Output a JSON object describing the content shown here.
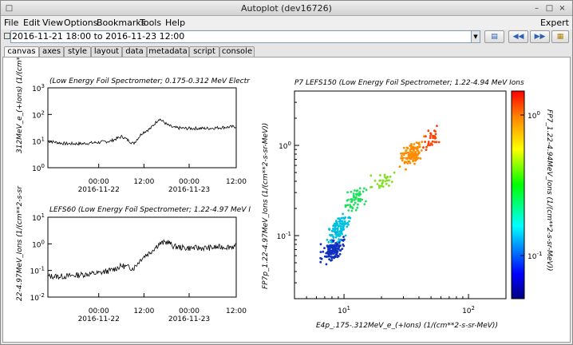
{
  "window": {
    "title": "Autoplot (dev16726)"
  },
  "menubar": {
    "items": [
      "File",
      "Edit",
      "View",
      "Options",
      "Bookmarks",
      "Tools",
      "Help"
    ],
    "expert_label": "Expert"
  },
  "address": {
    "value": "2016-11-21 18:00 to 2016-11-23 12:00"
  },
  "tabs": [
    "canvas",
    "axes",
    "style",
    "layout",
    "data",
    "metadata",
    "script",
    "console"
  ],
  "active_tab": "canvas",
  "icons": {
    "dropdown": "chevron-down-icon",
    "bookmark": "bookmark-icon",
    "prev": "step-back-icon",
    "next": "step-forward-icon",
    "open": "folder-icon"
  },
  "plots": {
    "top_left": {
      "title": "(Low Energy Foil Spectrometer; 0.175-0.312 MeV Electr",
      "ylabel": "312MeV_e_(+Ions) (1/(cm**2-s",
      "yticks": [
        {
          "base": "10",
          "exp": "3"
        },
        {
          "base": "10",
          "exp": "2"
        },
        {
          "base": "10",
          "exp": "1"
        },
        {
          "base": "10",
          "exp": "0"
        }
      ],
      "xticks": [
        "00:00",
        "12:00",
        "00:00",
        "12:00"
      ],
      "xdates": [
        "2016-11-22",
        "2016-11-23"
      ]
    },
    "bottom_left": {
      "title": "LEFS60 (Low Energy Foil Spectrometer; 1.22-4.97 MeV I",
      "ylabel": "22-4.97MeV_Ions (1/(cm**2-s-sr",
      "yticks": [
        {
          "base": "10",
          "exp": "1"
        },
        {
          "base": "10",
          "exp": "0"
        },
        {
          "base": "10",
          "exp": "-1"
        },
        {
          "base": "10",
          "exp": "-2"
        }
      ],
      "xticks": [
        "00:00",
        "12:00",
        "00:00",
        "12:00"
      ],
      "xdates": [
        "2016-11-22",
        "2016-11-23"
      ]
    },
    "scatter": {
      "title": "P7 LEFS150 (Low Energy Foil Spectrometer; 1.22-4.94 MeV Ions",
      "xlabel": "E4p_.175-.312MeV_e_(+Ions) (1/(cm**2-s-sr-MeV))",
      "ylabel": "FP7p_1.22-4.97MeV_Ions (1/(cm**2-s-sr-MeV))",
      "yticks": [
        {
          "base": "10",
          "exp": "0"
        },
        {
          "base": "10",
          "exp": "-1"
        }
      ],
      "xticks": [
        {
          "base": "10",
          "exp": "1"
        },
        {
          "base": "10",
          "exp": "2"
        }
      ],
      "colorbar_label": "FP7_1.22-4.94MeV_Ions (1/(cm**2-s-sr-MeV))",
      "colorbar_ticks": [
        {
          "base": "10",
          "exp": "0"
        },
        {
          "base": "10",
          "exp": "-1"
        }
      ]
    }
  },
  "chart_data": [
    {
      "type": "line",
      "title": "(Low Energy Foil Spectrometer; 0.175-0.312 MeV Electr",
      "ylabel": "312MeV_e_(+Ions) (1/(cm**2-s",
      "yscale": "log",
      "ylim": [
        1,
        1000
      ],
      "x_hours": [
        0,
        6,
        12,
        18,
        22,
        26,
        30,
        33,
        36,
        39,
        42,
        44,
        48,
        52,
        56,
        60,
        66
      ],
      "x_unit": "hours since 2016-11-21 18:00",
      "y": [
        10,
        8,
        8,
        9,
        10,
        15,
        8,
        20,
        30,
        70,
        40,
        32,
        30,
        30,
        30,
        32,
        35
      ]
    },
    {
      "type": "line",
      "title": "LEFS60 (Low Energy Foil Spectrometer; 1.22-4.97 MeV I",
      "ylabel": "22-4.97MeV_Ions (1/(cm**2-s-sr",
      "yscale": "log",
      "ylim": [
        0.01,
        10
      ],
      "x_hours": [
        0,
        6,
        12,
        18,
        22,
        26,
        30,
        33,
        36,
        39,
        42,
        44,
        48,
        52,
        56,
        60,
        66
      ],
      "x_unit": "hours since 2016-11-21 18:00",
      "y": [
        0.06,
        0.06,
        0.07,
        0.08,
        0.1,
        0.15,
        0.12,
        0.3,
        0.5,
        1.0,
        1.2,
        0.8,
        0.7,
        0.7,
        0.7,
        0.75,
        0.8
      ]
    },
    {
      "type": "scatter",
      "title": "P7 LEFS150 (Low Energy Foil Spectrometer; 1.22-4.94 MeV Ions",
      "xlabel": "E4p_.175-.312MeV_e_(+Ions) (1/(cm**2-s-sr-MeV))",
      "ylabel": "FP7p_1.22-4.97MeV_Ions (1/(cm**2-s-sr-MeV))",
      "xscale": "log",
      "yscale": "log",
      "xlim": [
        4,
        200
      ],
      "ylim": [
        0.02,
        4
      ],
      "clusters": [
        {
          "x": 8,
          "y": 0.07,
          "color": "#1030c0"
        },
        {
          "x": 9,
          "y": 0.12,
          "color": "#00c0e0"
        },
        {
          "x": 12,
          "y": 0.25,
          "color": "#20e060"
        },
        {
          "x": 20,
          "y": 0.4,
          "color": "#80e020"
        },
        {
          "x": 35,
          "y": 0.8,
          "color": "#ff8c00"
        },
        {
          "x": 50,
          "y": 1.2,
          "color": "#ff4000"
        }
      ]
    }
  ]
}
